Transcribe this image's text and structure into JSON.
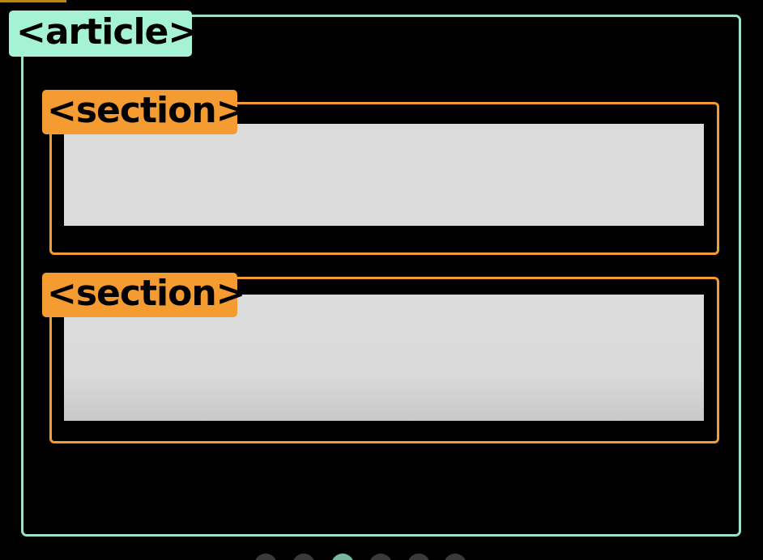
{
  "diagram": {
    "article_tag": "<article>",
    "sections": [
      {
        "tag": "<section>"
      },
      {
        "tag": "<section>"
      }
    ]
  },
  "pager": {
    "total": 6,
    "active_index": 2
  },
  "colors": {
    "article": "#9fe0c8",
    "section": "#f49b32",
    "content": "#dcdcdc",
    "background": "#000000"
  }
}
